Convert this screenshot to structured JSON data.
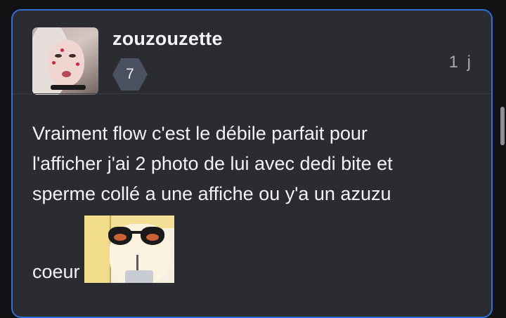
{
  "post": {
    "username": "zouzouzette",
    "badge_count": "7",
    "time_ago": "1 j",
    "lines": [
      "Vraiment flow c'est le débile parfait pour",
      "l'afficher j'ai 2 photo de lui avec dedi bite et",
      "sperme collé a une affiche ou y'a un azuzu"
    ],
    "last_word": "coeur"
  },
  "colors": {
    "card_border": "#2f6fd6",
    "card_bg": "#2b2c31",
    "badge_bg": "#4a5160",
    "page_bg": "#121214"
  },
  "icons": {
    "avatar": "avatar-image",
    "sticker": "sticker-image"
  }
}
